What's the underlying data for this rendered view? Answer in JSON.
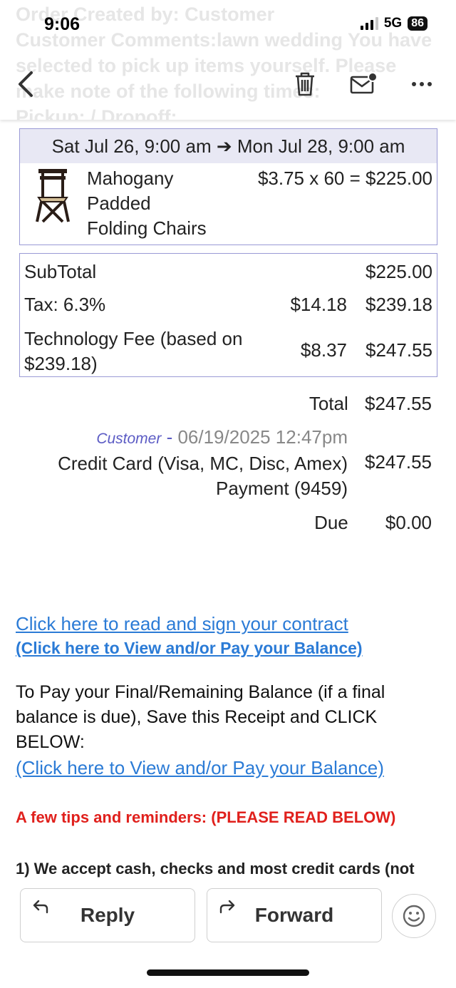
{
  "status_bar": {
    "time": "9:06",
    "network": "5G",
    "battery": "86"
  },
  "scrolled_text": [
    "Order Created by: Customer",
    "Customer Comments:lawn wedding You have",
    "selected to pick up items yourself. Please",
    "make note of the following times:",
    "Pickup: / Dropoff:"
  ],
  "booking": {
    "date_range": "Sat Jul 26, 9:00 am ➔ Mon Jul 28, 9:00 am",
    "item_name_lines": [
      "Mahogany",
      "Padded",
      "Folding Chairs"
    ],
    "item_price": "$3.75 x 60 = $225.00"
  },
  "totals": {
    "subtotal_label": "SubTotal",
    "subtotal_value": "$225.00",
    "tax_label": "Tax: 6.3%",
    "tax_amount": "$14.18",
    "tax_total": "$239.18",
    "fee_label_lines": [
      "Technology Fee (based on",
      "$239.18)"
    ],
    "fee_amount": "$8.37",
    "fee_total": "$247.55"
  },
  "summary": {
    "total_label": "Total",
    "total_value": "$247.55",
    "payment_by": "Customer",
    "payment_sep": " - ",
    "payment_date": "06/19/2025 12:47pm",
    "payment_desc_lines": [
      "Credit Card (Visa, MC, Disc, Amex)",
      "Payment (9459)"
    ],
    "payment_amount": "$247.55",
    "due_label": "Due",
    "due_value": "$0.00"
  },
  "links": {
    "contract": "Click here to read and sign your contract",
    "view_pay_1": "(Click here to View and/or Pay your Balance)",
    "view_pay_2": "(Click here to View and/or Pay your Balance)"
  },
  "body_text": {
    "final_balance_lines": [
      "To Pay your Final/Remaining Balance (if a final",
      "balance is due), Save this Receipt and CLICK",
      "BELOW:"
    ],
    "tips_heading": "A few tips and reminders: (PLEASE READ BELOW)",
    "tip_1": "1) We accept cash, checks and most credit cards (not"
  },
  "actions": {
    "reply": "Reply",
    "forward": "Forward"
  },
  "icons": [
    "back-chevron-icon",
    "trash-icon",
    "mail-unread-icon",
    "more-icon",
    "reply-arrow-icon",
    "forward-arrow-icon",
    "emoji-icon",
    "chair-image"
  ],
  "colors": {
    "link": "#2b7bd6",
    "tips_red": "#e0201c",
    "booking_header_bg": "#e8e8f4",
    "border": "#9a9ad6",
    "payer": "#5b5bc4"
  }
}
